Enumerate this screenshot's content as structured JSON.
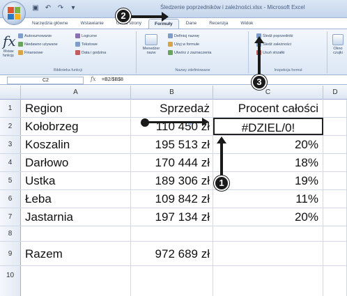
{
  "window": {
    "title": "Śledzenie poprzedników i zależności.xlsx - Microsoft Excel",
    "qat_icons": [
      "save-icon",
      "undo-icon",
      "redo-icon",
      "customize-icon"
    ]
  },
  "tabs": [
    {
      "label": "Narzędzia główne",
      "active": false
    },
    {
      "label": "Wstawianie",
      "active": false
    },
    {
      "label": "Układ strony",
      "active": false
    },
    {
      "label": "Formuły",
      "active": true
    },
    {
      "label": "Dane",
      "active": false
    },
    {
      "label": "Recenzja",
      "active": false
    },
    {
      "label": "Widok",
      "active": false
    }
  ],
  "ribbon": {
    "function_library": {
      "insert_function": "Wstaw funkcję",
      "autosum": "Autosumowanie",
      "recent": "Niedawno używane",
      "financial": "Finansowe",
      "logical": "Logiczne",
      "text": "Tekstowe",
      "date_time": "Data i godzina",
      "label": "Biblioteka funkcji"
    },
    "defined_names": {
      "name_manager": "Menedżer nazw",
      "define_name": "Definiuj nazwę",
      "use_in_formula": "Użyj w formule",
      "create_from_selection": "Utwórz z zaznaczenia",
      "label": "Nazwy zdefiniowane"
    },
    "formula_auditing": {
      "trace_precedents": "Śledź poprzedniki",
      "trace_dependents": "Śledź zależności",
      "remove_arrows": "Usuń strzałki",
      "label": "Inspekcja formuł"
    },
    "window": {
      "watch_window": "Okno czujki"
    }
  },
  "formula_bar": {
    "name_box": "C2",
    "formula": "=B2/$B$8"
  },
  "columns": [
    "A",
    "B",
    "C",
    "D"
  ],
  "rows": [
    {
      "num": "1",
      "a": "Region",
      "b": "Sprzedaż",
      "c": "Procent całości"
    },
    {
      "num": "2",
      "a": "Kołobrzeg",
      "b": "110 450 zł",
      "c": "#DZIEL/0!"
    },
    {
      "num": "3",
      "a": "Koszalin",
      "b": "195 513 zł",
      "c": "20%"
    },
    {
      "num": "4",
      "a": "Darłowo",
      "b": "170 444 zł",
      "c": "18%"
    },
    {
      "num": "5",
      "a": "Ustka",
      "b": "189 306 zł",
      "c": "19%"
    },
    {
      "num": "6",
      "a": "Łeba",
      "b": "109 842 zł",
      "c": "11%"
    },
    {
      "num": "7",
      "a": "Jastarnia",
      "b": "197 134 zł",
      "c": "20%"
    },
    {
      "num": "8",
      "a": "",
      "b": "",
      "c": ""
    },
    {
      "num": "9",
      "a": "Razem",
      "b": "972 689 zł",
      "c": ""
    },
    {
      "num": "10",
      "a": "",
      "b": "",
      "c": ""
    }
  ],
  "callouts": [
    "1",
    "2",
    "3"
  ]
}
